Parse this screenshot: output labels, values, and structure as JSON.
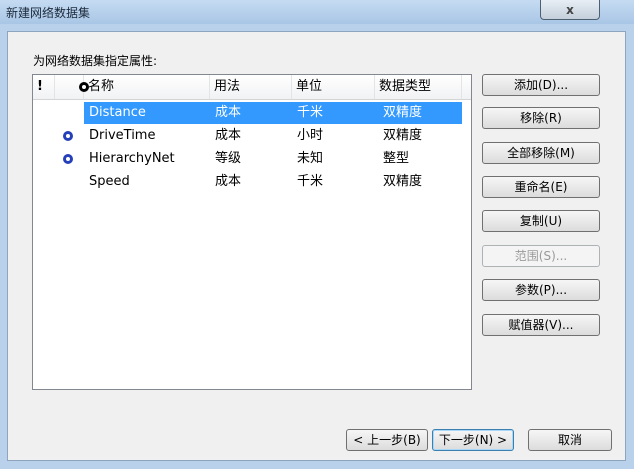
{
  "window": {
    "title": "新建网络数据集",
    "close_label": "x"
  },
  "prompt": "为网络数据集指定属性:",
  "table": {
    "headers": {
      "warning": "!",
      "name": "名称",
      "usage": "用法",
      "unit": "单位",
      "dtype": "数据类型"
    },
    "rows": [
      {
        "name": "Distance",
        "usage": "成本",
        "unit": "千米",
        "dtype": "双精度",
        "icon": "none",
        "selected": true
      },
      {
        "name": "DriveTime",
        "usage": "成本",
        "unit": "小时",
        "dtype": "双精度",
        "icon": "default-attribute-icon",
        "selected": false
      },
      {
        "name": "HierarchyNet",
        "usage": "等级",
        "unit": "未知",
        "dtype": "整型",
        "icon": "default-attribute-icon",
        "selected": false
      },
      {
        "name": "Speed",
        "usage": "成本",
        "unit": "千米",
        "dtype": "双精度",
        "icon": "none",
        "selected": false
      }
    ]
  },
  "buttons": {
    "add": "添加(D)...",
    "remove": "移除(R)",
    "remove_all": "全部移除(M)",
    "rename": "重命名(E)",
    "copy": "复制(U)",
    "range": "范围(S)...",
    "parameters": "参数(P)...",
    "evaluators": "赋值器(V)..."
  },
  "nav": {
    "back": "< 上一步(B)",
    "next": "下一步(N) >",
    "cancel": "取消"
  },
  "colors": {
    "selection": "#3399ff",
    "icon": "#2540b8"
  }
}
